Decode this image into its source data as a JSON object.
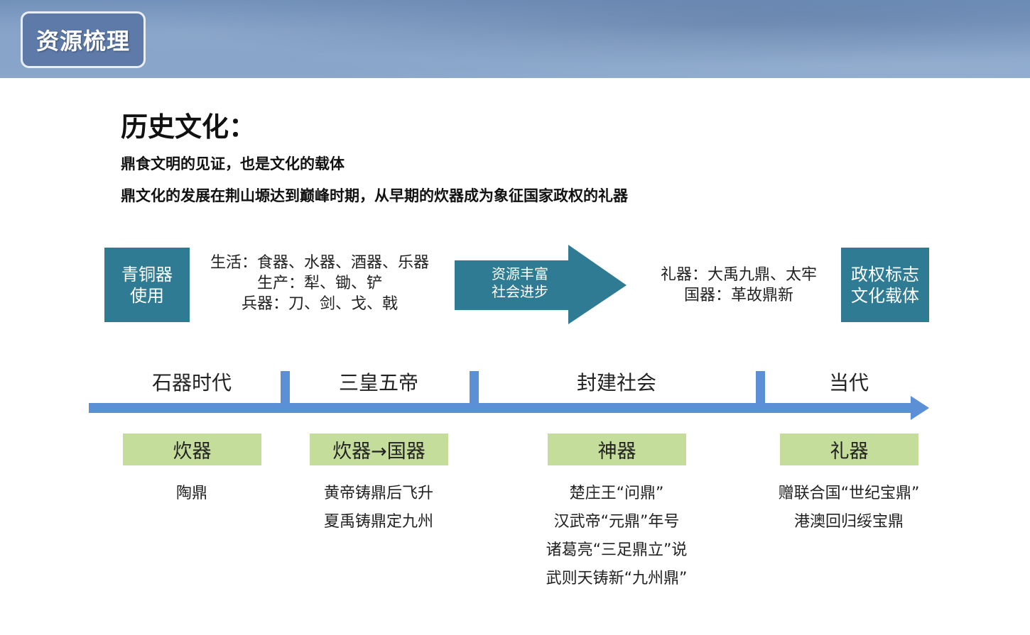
{
  "header": {
    "badge_label": "资源梳理"
  },
  "title": "历史文化：",
  "subtitle_lines": [
    "鼎食文明的见证，也是文化的载体",
    "鼎文化的发展在荆山塬达到巅峰时期，从早期的炊器成为象征国家政权的礼器"
  ],
  "flow": {
    "left_box": [
      "青铜器",
      "使用"
    ],
    "left_uses": [
      "生活：食器、水器、酒器、乐器",
      "生产：犁、锄、铲",
      "兵器：刀、剑、戈、戟"
    ],
    "arrow_text": [
      "资源丰富",
      "社会进步"
    ],
    "right_uses": [
      "礼器：大禹九鼎、太牢",
      "国器：革故鼎新"
    ],
    "right_box": [
      "政权标志",
      "文化载体"
    ],
    "colors": {
      "teal": "#2f7b93",
      "timeline_blue": "#5b8fd6",
      "green": "#c5dd9a"
    }
  },
  "timeline": {
    "eras": [
      "石器时代",
      "三皇五帝",
      "封建社会",
      "当代"
    ],
    "categories": [
      "炊器",
      "炊器→国器",
      "神器",
      "礼器"
    ],
    "examples": [
      [
        "陶鼎"
      ],
      [
        "黄帝铸鼎后飞升",
        "夏禹铸鼎定九州"
      ],
      [
        "楚庄王“问鼎”",
        "汉武帝“元鼎”年号",
        "诸葛亮“三足鼎立”说",
        "武则天铸新“九州鼎”"
      ],
      [
        "赠联合国“世纪宝鼎”",
        "港澳回归绥宝鼎"
      ]
    ]
  }
}
